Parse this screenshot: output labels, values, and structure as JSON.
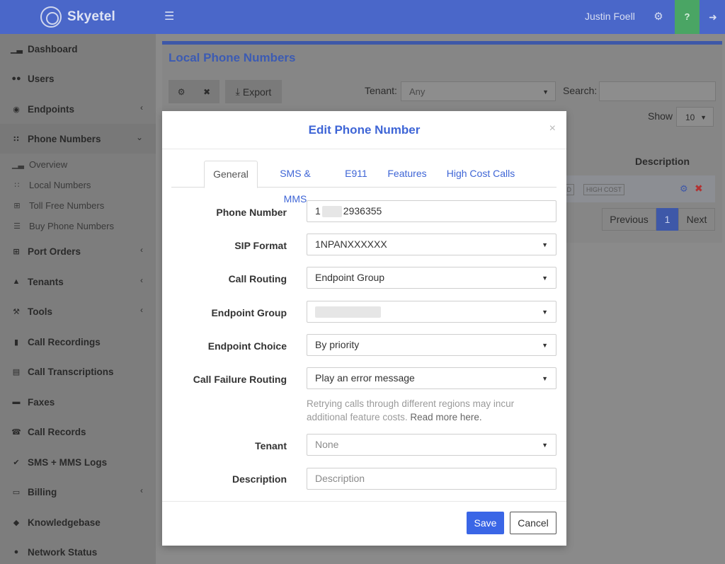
{
  "topbar": {
    "brand": "Skyetel",
    "username": "Justin Foell",
    "help": "?",
    "icons": {
      "menu": "hamburger-icon",
      "settings": "gears-icon",
      "logout": "sign-out-icon"
    },
    "colors": {
      "bar": "#4a67c9",
      "help_bg": "#4aa564"
    }
  },
  "sidebar": {
    "items": [
      {
        "label": "Dashboard",
        "icon": "bar-chart-icon",
        "glyph": "▁▃"
      },
      {
        "label": "Users",
        "icon": "users-icon",
        "glyph": "●●"
      },
      {
        "label": "Endpoints",
        "icon": "target-icon",
        "glyph": "◉",
        "chevron": "‹"
      },
      {
        "label": "Phone Numbers",
        "icon": "keypad-icon",
        "glyph": "∷",
        "chevron": "⌄"
      },
      {
        "label": "Port Orders",
        "icon": "plus-square-icon",
        "glyph": "⊞",
        "chevron": "‹"
      },
      {
        "label": "Tenants",
        "icon": "user-icon",
        "glyph": "▲",
        "chevron": "‹"
      },
      {
        "label": "Tools",
        "icon": "tools-icon",
        "glyph": "⚒",
        "chevron": "‹"
      },
      {
        "label": "Call Recordings",
        "icon": "microphone-icon",
        "glyph": "▮"
      },
      {
        "label": "Call Transcriptions",
        "icon": "file-text-icon",
        "glyph": "▤"
      },
      {
        "label": "Faxes",
        "icon": "fax-icon",
        "glyph": "▬"
      },
      {
        "label": "Call Records",
        "icon": "phone-icon",
        "glyph": "☎"
      },
      {
        "label": "SMS + MMS Logs",
        "icon": "check-icon",
        "glyph": "✔"
      },
      {
        "label": "Billing",
        "icon": "credit-card-icon",
        "glyph": "▭",
        "chevron": "‹"
      },
      {
        "label": "Knowledgebase",
        "icon": "graduation-cap-icon",
        "glyph": "◆"
      },
      {
        "label": "Network Status",
        "icon": "info-circle-icon",
        "glyph": "●"
      }
    ],
    "sub_items": [
      {
        "label": "Overview",
        "icon": "bar-chart-icon",
        "glyph": "▁▃"
      },
      {
        "label": "Local Numbers",
        "icon": "keypad-icon",
        "glyph": "∷"
      },
      {
        "label": "Toll Free Numbers",
        "icon": "grid-icon",
        "glyph": "⊞"
      },
      {
        "label": "Buy Phone Numbers",
        "icon": "list-icon",
        "glyph": "☰"
      }
    ]
  },
  "page": {
    "title": "Local Phone Numbers",
    "toolbar": {
      "gear": "⚙",
      "close": "✖",
      "export_label": "Export",
      "export_glyph": "⤓"
    },
    "tenant_label": "Tenant:",
    "tenant_value": "Any",
    "search_label": "Search:",
    "show_label": "Show",
    "show_value": "10",
    "column_description": "Description",
    "row_tags": [
      "RD",
      "HIGH COST"
    ],
    "pager": {
      "previous": "Previous",
      "page": "1",
      "next": "Next"
    }
  },
  "modal": {
    "title": "Edit Phone Number",
    "close": "×",
    "tabs": [
      "General",
      "SMS & MMS",
      "E911",
      "Features",
      "High Cost Calls"
    ],
    "fields": {
      "phone_number": {
        "label": "Phone Number",
        "prefix": "1",
        "suffix": "2936355"
      },
      "sip_format": {
        "label": "SIP Format",
        "value": "1NPANXXXXXX"
      },
      "call_routing": {
        "label": "Call Routing",
        "value": "Endpoint Group"
      },
      "endpoint_group": {
        "label": "Endpoint Group"
      },
      "endpoint_choice": {
        "label": "Endpoint Choice",
        "value": "By priority"
      },
      "call_failure_routing": {
        "label": "Call Failure Routing",
        "value": "Play an error message"
      },
      "tenant": {
        "label": "Tenant",
        "value": "None"
      },
      "description": {
        "label": "Description",
        "placeholder": "Description"
      }
    },
    "help_text": "Retrying calls through different regions may incur additional feature costs.",
    "help_link": "Read more here.",
    "save": "Save",
    "cancel": "Cancel",
    "colors": {
      "accent": "#3e65d6",
      "save_bg": "#3a66e6"
    }
  }
}
